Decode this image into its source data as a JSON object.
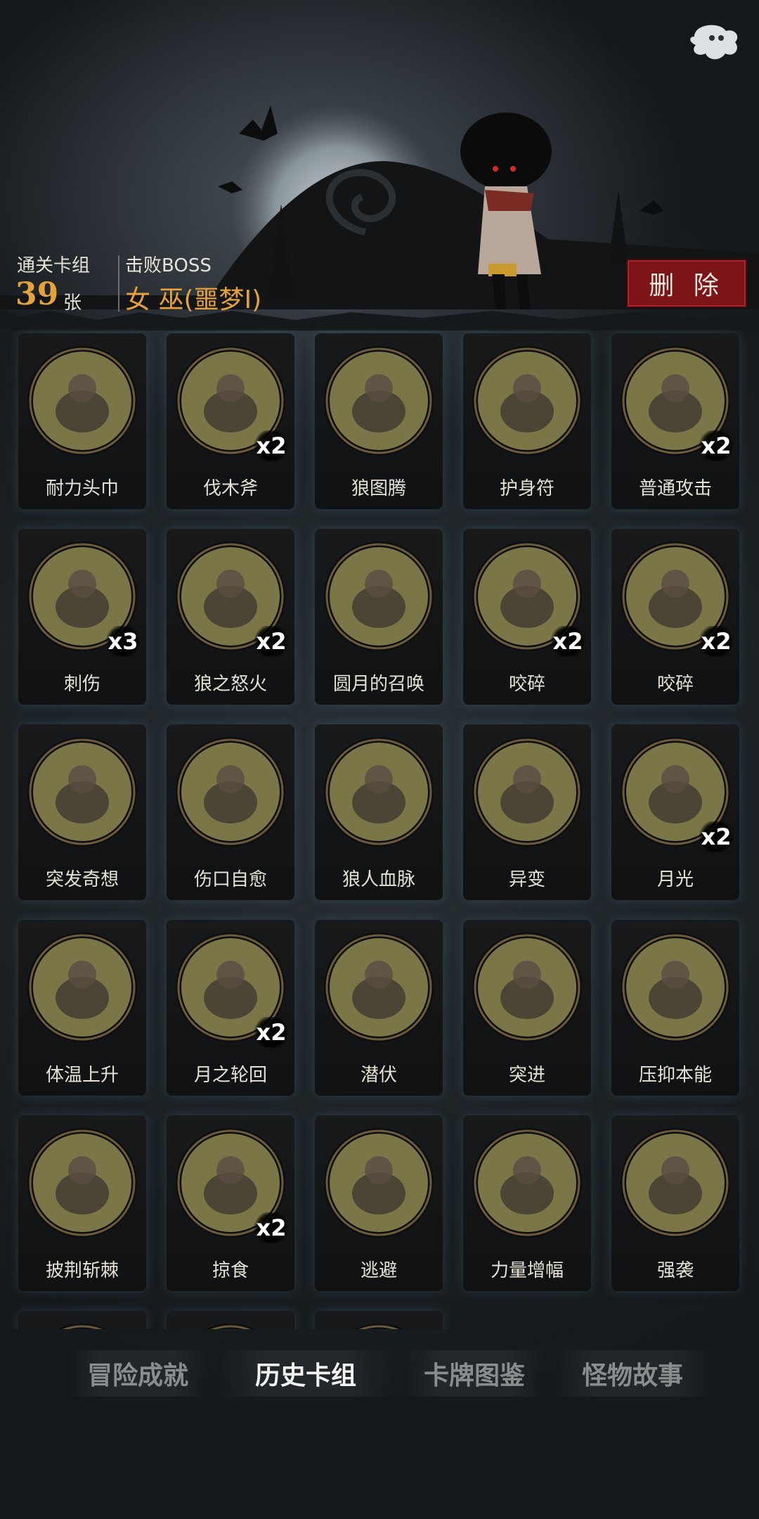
{
  "header": {
    "cards_label": "通关卡组",
    "cards_count": "39",
    "cards_unit": "张",
    "boss_label": "击败BOSS",
    "boss_name": "女 巫(噩梦I)",
    "delete_button": "删 除",
    "settings_icon": "ghost-settings-icon"
  },
  "cards": [
    {
      "name": "耐力头巾",
      "count": "",
      "icon": "bandana-icon"
    },
    {
      "name": "伐木斧",
      "count": "x2",
      "icon": "axe-icon"
    },
    {
      "name": "狼图腾",
      "count": "",
      "icon": "wolf-totem-icon"
    },
    {
      "name": "护身符",
      "count": "",
      "icon": "amulet-icon"
    },
    {
      "name": "普通攻击",
      "count": "x2",
      "icon": "slash-attack-icon"
    },
    {
      "name": "刺伤",
      "count": "x3",
      "icon": "dagger-stab-icon"
    },
    {
      "name": "狼之怒火",
      "count": "x2",
      "icon": "wolf-rage-icon"
    },
    {
      "name": "圆月的召唤",
      "count": "",
      "icon": "full-moon-forest-icon"
    },
    {
      "name": "咬碎",
      "count": "x2",
      "icon": "bite-claw-icon"
    },
    {
      "name": "咬碎",
      "count": "x2",
      "icon": "bite-claw-icon"
    },
    {
      "name": "突发奇想",
      "count": "",
      "icon": "idea-scientist-icon"
    },
    {
      "name": "伤口自愈",
      "count": "",
      "icon": "self-heal-icon"
    },
    {
      "name": "狼人血脉",
      "count": "",
      "icon": "werewolf-hand-icon"
    },
    {
      "name": "异变",
      "count": "",
      "icon": "mutation-icon"
    },
    {
      "name": "月光",
      "count": "x2",
      "icon": "moonlight-icon"
    },
    {
      "name": "体温上升",
      "count": "",
      "icon": "fire-wolf-icon"
    },
    {
      "name": "月之轮回",
      "count": "x2",
      "icon": "moon-phases-icon"
    },
    {
      "name": "潜伏",
      "count": "",
      "icon": "lurking-wolf-icon"
    },
    {
      "name": "突进",
      "count": "",
      "icon": "charge-wolf-icon"
    },
    {
      "name": "压抑本能",
      "count": "",
      "icon": "suppress-instinct-icon"
    },
    {
      "name": "披荆斩棘",
      "count": "",
      "icon": "thorn-cleave-icon"
    },
    {
      "name": "掠食",
      "count": "x2",
      "icon": "predator-wolf-icon"
    },
    {
      "name": "逃避",
      "count": "",
      "icon": "escape-bear-icon"
    },
    {
      "name": "力量增幅",
      "count": "",
      "icon": "log-lift-icon"
    },
    {
      "name": "强袭",
      "count": "",
      "icon": "assault-wolf-icon"
    },
    {
      "name": "",
      "count": "",
      "icon": "hidden-card-icon"
    },
    {
      "name": "",
      "count": "",
      "icon": "hidden-card-icon"
    },
    {
      "name": "",
      "count": "",
      "icon": "hidden-card-icon"
    }
  ],
  "tabs": [
    {
      "label": "冒险成就",
      "active": false
    },
    {
      "label": "历史卡组",
      "active": true
    },
    {
      "label": "卡牌图鉴",
      "active": false
    },
    {
      "label": "怪物故事",
      "active": false
    }
  ],
  "colors": {
    "accent_orange": "#e6a23a",
    "delete_red": "#7c1418",
    "disc_olive": "#7b7648"
  }
}
